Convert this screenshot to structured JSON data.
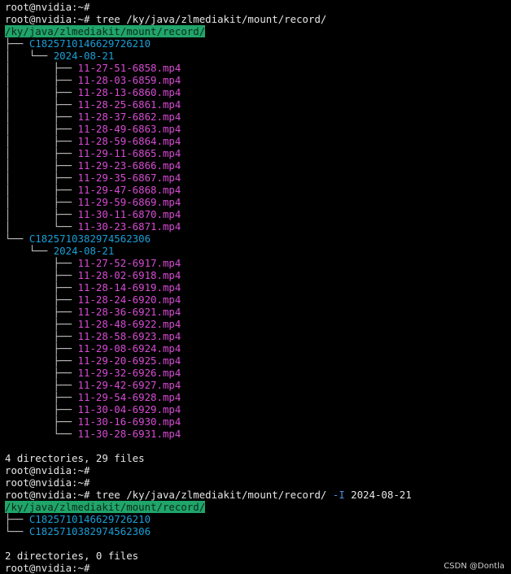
{
  "prompt": "root@nvidia:~#",
  "command1": {
    "cmd": "tree /ky/java/zlmediakit/mount/record/",
    "root": "/ky/java/zlmediakit/mount/record/",
    "streams": [
      {
        "id": "C1825710146629726210",
        "date": "2024-08-21",
        "files": [
          "11-27-51-6858.mp4",
          "11-28-03-6859.mp4",
          "11-28-13-6860.mp4",
          "11-28-25-6861.mp4",
          "11-28-37-6862.mp4",
          "11-28-49-6863.mp4",
          "11-28-59-6864.mp4",
          "11-29-11-6865.mp4",
          "11-29-23-6866.mp4",
          "11-29-35-6867.mp4",
          "11-29-47-6868.mp4",
          "11-29-59-6869.mp4",
          "11-30-11-6870.mp4",
          "11-30-23-6871.mp4"
        ]
      },
      {
        "id": "C1825710382974562306",
        "date": "2024-08-21",
        "files": [
          "11-27-52-6917.mp4",
          "11-28-02-6918.mp4",
          "11-28-14-6919.mp4",
          "11-28-24-6920.mp4",
          "11-28-36-6921.mp4",
          "11-28-48-6922.mp4",
          "11-28-58-6923.mp4",
          "11-29-08-6924.mp4",
          "11-29-20-6925.mp4",
          "11-29-32-6926.mp4",
          "11-29-42-6927.mp4",
          "11-29-54-6928.mp4",
          "11-30-04-6929.mp4",
          "11-30-16-6930.mp4",
          "11-30-28-6931.mp4"
        ]
      }
    ],
    "summary": "4 directories, 29 files"
  },
  "command2": {
    "cmd": "tree /ky/java/zlmediakit/mount/record/",
    "flag": "-I",
    "arg": "2024-08-21",
    "root": "/ky/java/zlmediakit/mount/record/",
    "entries": [
      "C1825710146629726210",
      "C1825710382974562306"
    ],
    "summary": "2 directories, 0 files"
  },
  "watermark": "CSDN @Dontla",
  "colors": {
    "background": "#000000",
    "text": "#e6e6e6",
    "directory": "#1a9fd8",
    "mp4": "#d84bd4",
    "highlight": "#20a56a"
  }
}
